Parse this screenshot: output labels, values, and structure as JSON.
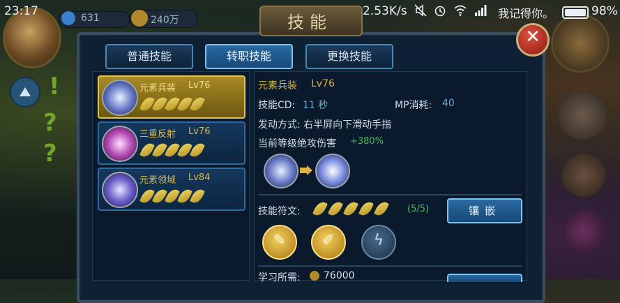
{
  "status_bar": {
    "time": "23:17",
    "speed": "2.53K/s",
    "carrier": "我记得你。",
    "battery": "98%",
    "icons": [
      "mute-icon",
      "alarm-icon",
      "wifi-icon",
      "signal-icon"
    ]
  },
  "hud": {
    "gems": "631",
    "gold": "240万"
  },
  "title": "技能",
  "tabs": [
    {
      "label": "普通技能",
      "active": false
    },
    {
      "label": "转职技能",
      "active": true
    },
    {
      "label": "更换技能",
      "active": false
    }
  ],
  "skills": [
    {
      "name": "元素兵装",
      "level": "Lv76",
      "leaves": 5,
      "selected": true
    },
    {
      "name": "三重反射",
      "level": "Lv76",
      "leaves": 5,
      "selected": false
    },
    {
      "name": "元素领域",
      "level": "Lv84",
      "leaves": 5,
      "selected": false
    }
  ],
  "detail": {
    "name": "元素兵装",
    "level": "Lv76",
    "cd_label": "技能CD:",
    "cd_value": "11 秒",
    "mp_label": "MP消耗:",
    "mp_value": "40",
    "trigger": "发动方式: 右半屏向下滑动手指",
    "damage_label": "当前等级绝攻伤害",
    "damage_value": "+380%",
    "runes_label": "技能符文:",
    "runes_count": "(5/5)",
    "runes_filled": 5,
    "inlay_button": "镶嵌",
    "learn_label": "学习所需:",
    "learn_value": "76000"
  },
  "colors": {
    "accent_gold": "#d9b64a",
    "accent_blue": "#6aa8d8",
    "bonus_green": "#3fbf5a",
    "close_red": "#c0302a"
  }
}
